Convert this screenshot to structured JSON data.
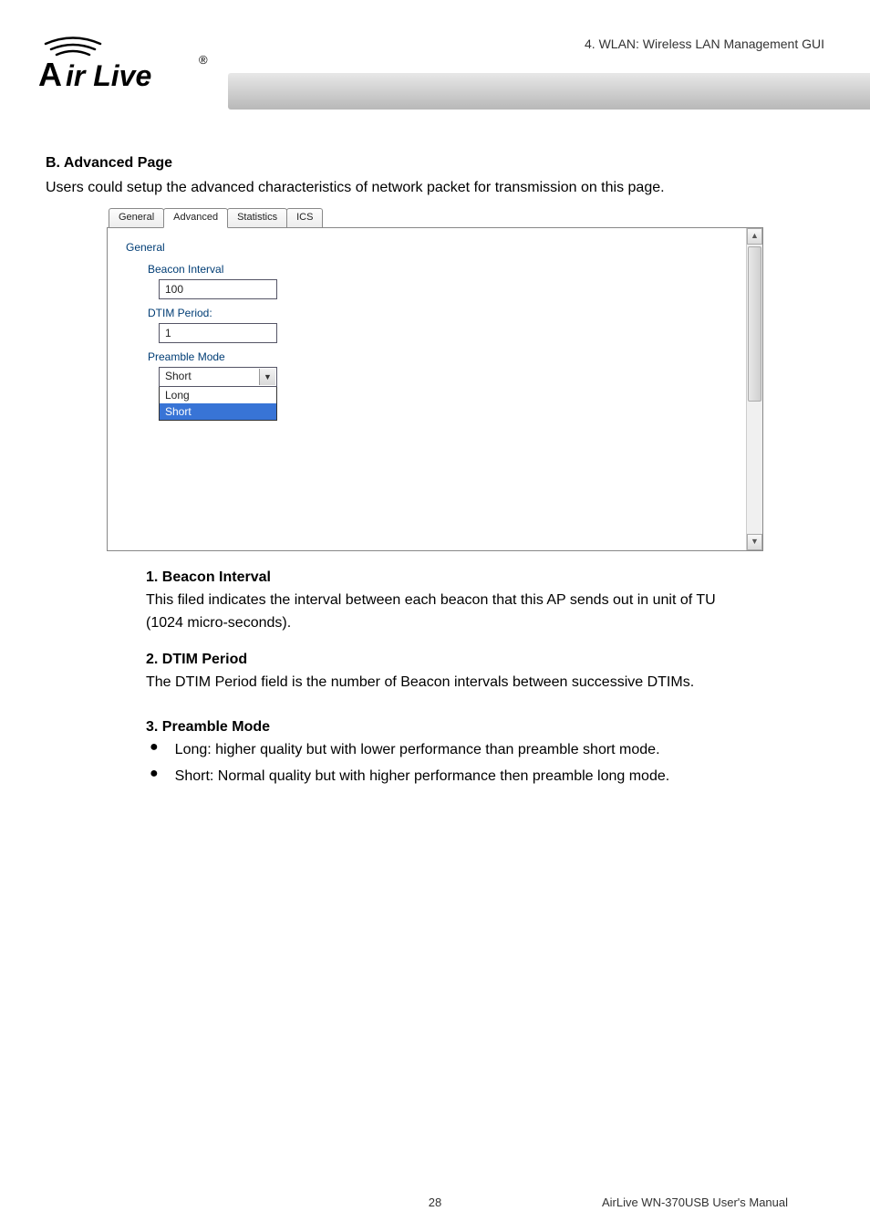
{
  "header": {
    "chapter_label": "4.  WLAN:  Wireless  LAN  Management  GUI",
    "logo_brand": "Air Live",
    "logo_reg": "®"
  },
  "section_b": {
    "title": "B. Advanced Page",
    "intro": "Users could setup the advanced characteristics of network packet for transmission on this page."
  },
  "tabs": {
    "general": "General",
    "advanced": "Advanced",
    "statistics": "Statistics",
    "ics": "ICS"
  },
  "panel": {
    "group_title": "General",
    "beacon_label": "Beacon Interval",
    "beacon_value": "100",
    "dtim_label": "DTIM Period:",
    "dtim_value": "1",
    "preamble_label": "Preamble Mode",
    "preamble_selected": "Short",
    "preamble_opt_long": "Long",
    "preamble_opt_short": "Short"
  },
  "desc": {
    "h1": "1. Beacon Interval",
    "p1": "This filed indicates the interval between each beacon that this AP sends out in unit of TU (1024 micro-seconds).",
    "h2": "2. DTIM Period",
    "p2": "The DTIM Period field is the number of Beacon intervals between successive DTIMs.",
    "h3": "3. Preamble Mode",
    "b1": "Long: higher quality but with lower performance than preamble short mode.",
    "b2": "Short: Normal quality but with higher performance then preamble long mode."
  },
  "footer": {
    "page": "28",
    "manual": "AirLive WN-370USB User's Manual"
  }
}
